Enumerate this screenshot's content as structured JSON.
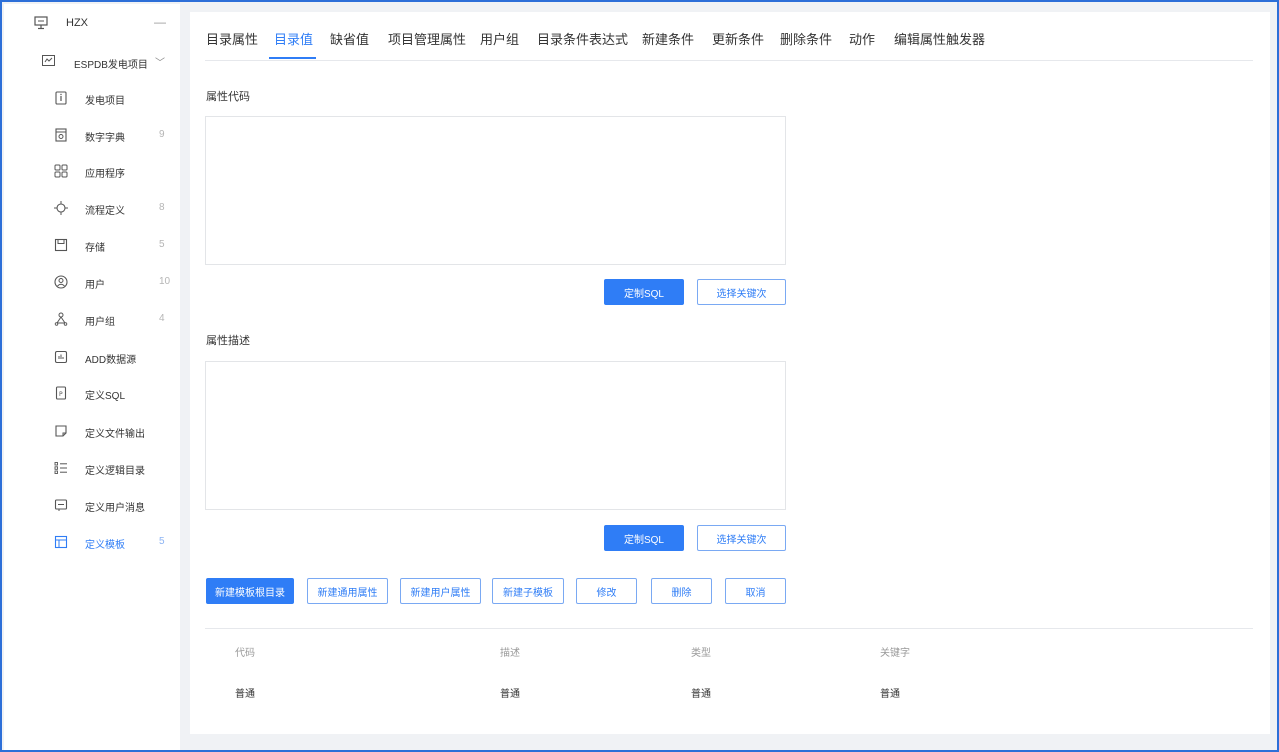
{
  "sidebar": {
    "root": {
      "label": "HZX",
      "collapse": "—"
    },
    "project": {
      "label": "ESPDB发电项目",
      "chevron": "﹀"
    },
    "items": [
      {
        "label": "发电项目",
        "count": ""
      },
      {
        "label": "数字字典",
        "count": "9"
      },
      {
        "label": "应用程序",
        "count": ""
      },
      {
        "label": "流程定义",
        "count": "8"
      },
      {
        "label": "存储",
        "count": "5"
      },
      {
        "label": "用户",
        "count": "10"
      },
      {
        "label": "用户组",
        "count": "4"
      },
      {
        "label": "ADD数据源",
        "count": ""
      },
      {
        "label": "定义SQL",
        "count": ""
      },
      {
        "label": "定义文件输出",
        "count": ""
      },
      {
        "label": "定义逻辑目录",
        "count": ""
      },
      {
        "label": "定义用户消息",
        "count": ""
      },
      {
        "label": "定义模板",
        "count": "5"
      }
    ]
  },
  "tabs": [
    "目录属性",
    "目录值",
    "缺省值",
    "项目管理属性",
    "用户组",
    "目录条件表达式",
    "新建条件",
    "更新条件",
    "删除条件",
    "动作",
    "编辑属性触发器"
  ],
  "active_tab": "目录值",
  "form": {
    "code_label": "属性代码",
    "desc_label": "属性描述",
    "custom_sql": "定制SQL",
    "select_keyword": "选择关键次"
  },
  "actions": [
    "新建模板根目录",
    "新建通用属性",
    "新建用户属性",
    "新建子模板",
    "修改",
    "删除",
    "取消"
  ],
  "table": {
    "headers": [
      "代码",
      "描述",
      "类型",
      "关键字"
    ],
    "rows": [
      [
        "普通",
        "普通",
        "普通",
        "普通"
      ]
    ]
  },
  "colors": {
    "accent": "#2f7df6",
    "frame": "#2d6fd8",
    "background": "#f0f2f5"
  }
}
